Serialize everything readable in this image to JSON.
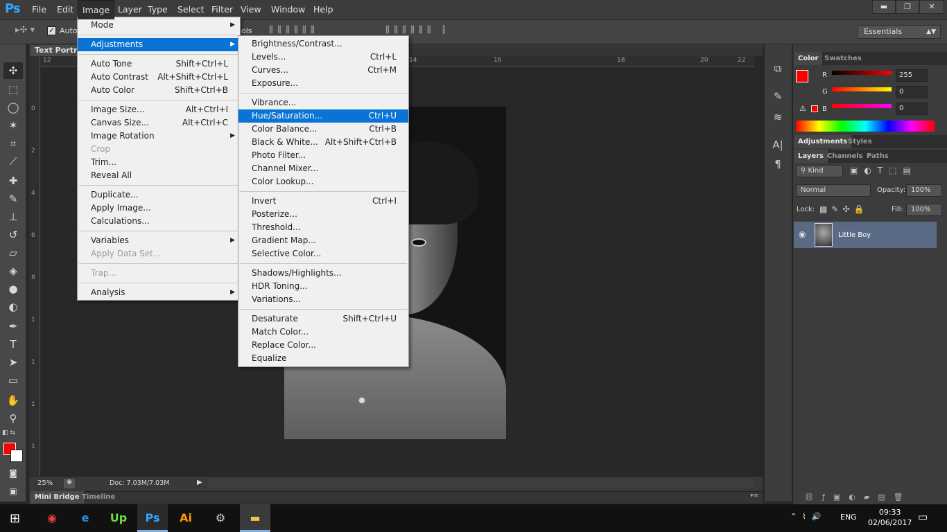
{
  "app": {
    "logo": "Ps"
  },
  "menubar": [
    "File",
    "Edit",
    "Image",
    "Layer",
    "Type",
    "Select",
    "Filter",
    "View",
    "Window",
    "Help"
  ],
  "window_buttons": {
    "minimize": "▬",
    "restore": "❐",
    "close": "✕"
  },
  "options": {
    "auto_label": "Auto-",
    "cut_text": "ols",
    "workspace": "Essentials"
  },
  "document": {
    "tab": "Text Portrait",
    "zoom": "25%",
    "doc_info": "Doc: 7.03M/7.03M"
  },
  "ruler": {
    "top": [
      "12",
      "14",
      "16",
      "18",
      "20",
      "22"
    ],
    "left": [
      "0",
      "2",
      "4",
      "6",
      "8",
      "1",
      "1",
      "1",
      "1"
    ]
  },
  "bottom_tabs": [
    "Mini Bridge",
    "Timeline"
  ],
  "color_panel": {
    "tabs": [
      "Color",
      "Swatches"
    ],
    "r_label": "R",
    "g_label": "G",
    "b_label": "B",
    "r": "255",
    "g": "0",
    "b": "0",
    "foreground": "#ff0000"
  },
  "adjustments_panel": {
    "tabs": [
      "Adjustments",
      "Styles"
    ]
  },
  "layers_panel": {
    "tabs": [
      "Layers",
      "Channels",
      "Paths"
    ],
    "kind": "Kind",
    "blend_mode": "Normal",
    "opacity_label": "Opacity:",
    "opacity": "100%",
    "lock_label": "Lock:",
    "fill_label": "Fill:",
    "fill": "100%",
    "layer_name": "Little Boy"
  },
  "image_menu": [
    {
      "label": "Mode",
      "arrow": "▶"
    },
    {
      "sep": true
    },
    {
      "label": "Adjustments",
      "arrow": "▶",
      "highlight": true
    },
    {
      "sep": true
    },
    {
      "label": "Auto Tone",
      "shortcut": "Shift+Ctrl+L"
    },
    {
      "label": "Auto Contrast",
      "shortcut": "Alt+Shift+Ctrl+L"
    },
    {
      "label": "Auto Color",
      "shortcut": "Shift+Ctrl+B"
    },
    {
      "sep": true
    },
    {
      "label": "Image Size...",
      "shortcut": "Alt+Ctrl+I"
    },
    {
      "label": "Canvas Size...",
      "shortcut": "Alt+Ctrl+C"
    },
    {
      "label": "Image Rotation",
      "arrow": "▶"
    },
    {
      "label": "Crop",
      "disabled": true
    },
    {
      "label": "Trim..."
    },
    {
      "label": "Reveal All"
    },
    {
      "sep": true
    },
    {
      "label": "Duplicate..."
    },
    {
      "label": "Apply Image..."
    },
    {
      "label": "Calculations..."
    },
    {
      "sep": true
    },
    {
      "label": "Variables",
      "arrow": "▶"
    },
    {
      "label": "Apply Data Set...",
      "disabled": true
    },
    {
      "sep": true
    },
    {
      "label": "Trap...",
      "disabled": true
    },
    {
      "sep": true
    },
    {
      "label": "Analysis",
      "arrow": "▶"
    }
  ],
  "adjustments_menu": [
    {
      "label": "Brightness/Contrast..."
    },
    {
      "label": "Levels...",
      "shortcut": "Ctrl+L"
    },
    {
      "label": "Curves...",
      "shortcut": "Ctrl+M"
    },
    {
      "label": "Exposure..."
    },
    {
      "sep": true
    },
    {
      "label": "Vibrance..."
    },
    {
      "label": "Hue/Saturation...",
      "shortcut": "Ctrl+U",
      "highlight": true
    },
    {
      "label": "Color Balance...",
      "shortcut": "Ctrl+B"
    },
    {
      "label": "Black & White...",
      "shortcut": "Alt+Shift+Ctrl+B"
    },
    {
      "label": "Photo Filter..."
    },
    {
      "label": "Channel Mixer..."
    },
    {
      "label": "Color Lookup..."
    },
    {
      "sep": true
    },
    {
      "label": "Invert",
      "shortcut": "Ctrl+I"
    },
    {
      "label": "Posterize..."
    },
    {
      "label": "Threshold..."
    },
    {
      "label": "Gradient Map..."
    },
    {
      "label": "Selective Color..."
    },
    {
      "sep": true
    },
    {
      "label": "Shadows/Highlights..."
    },
    {
      "label": "HDR Toning..."
    },
    {
      "label": "Variations..."
    },
    {
      "sep": true
    },
    {
      "label": "Desaturate",
      "shortcut": "Shift+Ctrl+U"
    },
    {
      "label": "Match Color..."
    },
    {
      "label": "Replace Color..."
    },
    {
      "label": "Equalize"
    }
  ],
  "taskbar": {
    "apps": [
      {
        "name": "chrome-icon",
        "glyph": "◉",
        "color": "#e84235"
      },
      {
        "name": "ie-icon",
        "glyph": "e",
        "color": "#2b8ae0"
      },
      {
        "name": "upwork-icon",
        "glyph": "Up",
        "color": "#6fda44"
      },
      {
        "name": "photoshop-icon",
        "glyph": "Ps",
        "color": "#31a8ff"
      },
      {
        "name": "illustrator-icon",
        "glyph": "Ai",
        "color": "#ff9a00"
      },
      {
        "name": "steam-icon",
        "glyph": "⚙",
        "color": "#c7d5e0"
      },
      {
        "name": "file-explorer-icon",
        "glyph": "▬",
        "color": "#f2c14e"
      }
    ],
    "language": "ENG",
    "time": "09:33",
    "date": "02/06/2017"
  }
}
